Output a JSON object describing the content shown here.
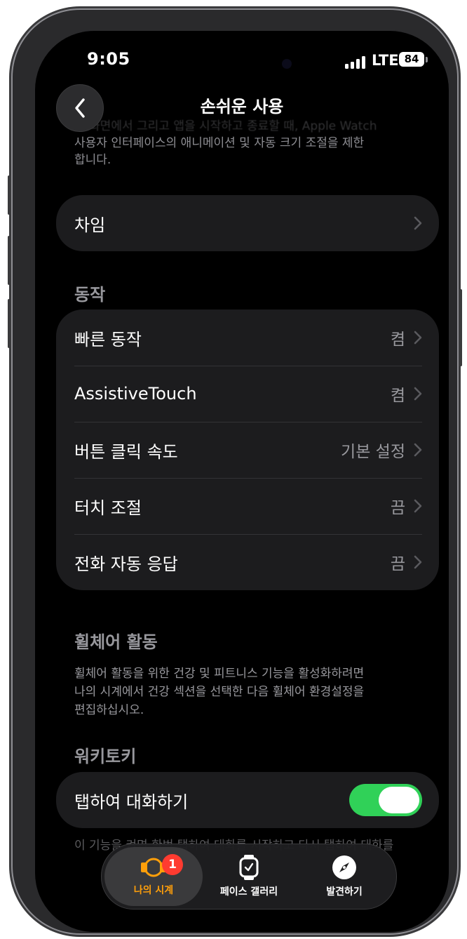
{
  "status_bar": {
    "time": "9:05",
    "network": "LTE",
    "battery": "84"
  },
  "nav": {
    "title": "손쉬운 사용"
  },
  "top_description": {
    "line1": "앱 화면에서 그리고 앱을 시작하고 종료할 때, Apple Watch",
    "line2": "사용자 인터페이스의 애니메이션 및 자동 크기 조절을 제한",
    "line3": "합니다."
  },
  "chime_group": {
    "label": "차임"
  },
  "motion_section": {
    "header": "동작",
    "rows": [
      {
        "label": "빠른 동작",
        "value": "켬"
      },
      {
        "label": "AssistiveTouch",
        "value": "켬"
      },
      {
        "label": "버튼 클릭 속도",
        "value": "기본 설정"
      },
      {
        "label": "터치 조절",
        "value": "끔"
      },
      {
        "label": "전화 자동 응답",
        "value": "끔"
      }
    ]
  },
  "wheelchair_section": {
    "header": "휠체어 활동",
    "line1": "휠체어 활동을 위한 건강 및 피트니스 기능을 활성화하려면",
    "line2": "나의 시계에서 건강 섹션을 선택한 다음 휠체어 환경설정을",
    "line3": "편집하십시오."
  },
  "walkie_section": {
    "header": "워키토키",
    "toggle_label": "탭하여 대화하기",
    "toggle_on": true,
    "footer": "이 기능을 켜면 한번 탭하여 대화를 시작하고 다시 탭하여 대화를"
  },
  "tabbar": {
    "tabs": [
      {
        "label": "나의 시계",
        "badge": "1"
      },
      {
        "label": "페이스 갤러리"
      },
      {
        "label": "발견하기"
      }
    ]
  },
  "colors": {
    "accent": "#ff9f0a",
    "toggle_on": "#30d158",
    "badge": "#ff3b30"
  }
}
